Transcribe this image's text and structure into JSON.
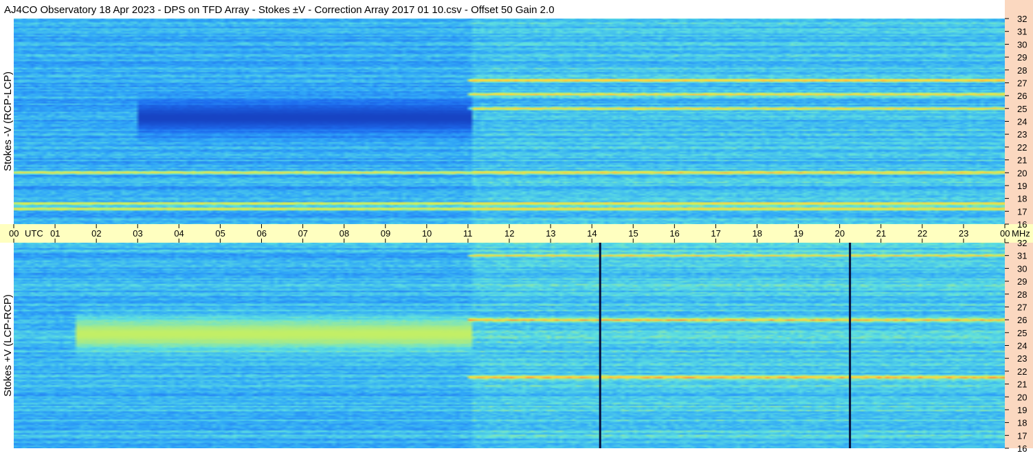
{
  "title": "AJ4CO Observatory  18 Apr 2023  -  DPS on TFD Array  -  Stokes ±V  -  Correction Array 2017 01 10.csv  -  Offset 50  Gain 2.0",
  "colors": {
    "background": "#ffffff",
    "time_axis_bg": "#ffffc0",
    "freq_axis_bg": "#fbd8c0",
    "colormap": [
      "#0a1a5c",
      "#1640c0",
      "#1e6ef0",
      "#30a8f8",
      "#5ee0e0",
      "#c8f060",
      "#ffd040",
      "#ff4040",
      "#ff40c0",
      "#ffffff"
    ]
  },
  "chart_data": {
    "type": "heatmap",
    "time_axis": {
      "unit": "UTC",
      "ticks": [
        "00",
        "01",
        "02",
        "03",
        "04",
        "05",
        "06",
        "07",
        "08",
        "09",
        "10",
        "11",
        "12",
        "13",
        "14",
        "15",
        "16",
        "17",
        "18",
        "19",
        "20",
        "21",
        "22",
        "23",
        "00"
      ],
      "range_hours": [
        0,
        24
      ]
    },
    "freq_axis": {
      "unit": "MHz",
      "ticks": [
        "32",
        "31",
        "30",
        "29",
        "28",
        "27",
        "26",
        "25",
        "24",
        "23",
        "22",
        "21",
        "20",
        "19",
        "18",
        "17",
        "16"
      ],
      "range_mhz": [
        16,
        32
      ]
    },
    "panels": [
      {
        "name": "Stokes -V (RCP-LCP)",
        "base_level": 0.34,
        "dark_region": {
          "t_start": 3.0,
          "t_end": 11.1,
          "f_center": 24.3,
          "f_width": 1.2,
          "level": 0.12
        },
        "bright_bands_mhz": [
          25.0,
          26.1,
          27.2,
          20.0,
          17.6,
          17.2
        ],
        "dark_lines_utc": []
      },
      {
        "name": "Stokes +V (LCP-RCP)",
        "base_level": 0.36,
        "bright_region": {
          "t_start": 1.5,
          "t_end": 11.1,
          "f_center": 24.9,
          "f_width": 1.3,
          "level": 0.55
        },
        "bright_bands_mhz": [
          26.0,
          31.0,
          21.5
        ],
        "dark_lines_utc": [
          14.2,
          20.25
        ]
      }
    ]
  }
}
